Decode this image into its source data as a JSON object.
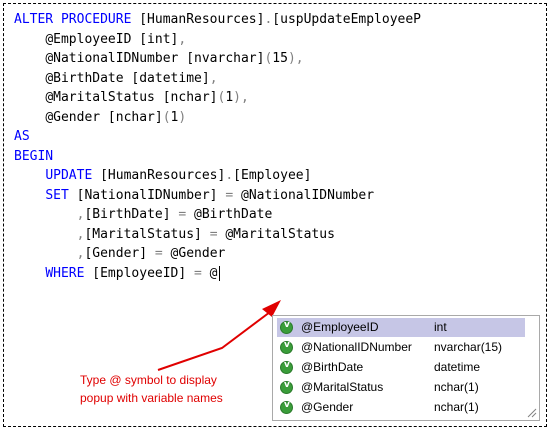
{
  "editor": {
    "lines": [
      {
        "indent": "",
        "segments": [
          {
            "text": "ALTER PROCEDURE",
            "color": "#0000ff"
          },
          {
            "text": " [HumanResources]",
            "color": "#000000"
          },
          {
            "text": ".",
            "color": "#808080"
          },
          {
            "text": "[uspUpdateEmployeeP",
            "color": "#000000"
          }
        ]
      },
      {
        "indent": "    ",
        "segments": [
          {
            "text": "@EmployeeID [int]",
            "color": "#000000"
          },
          {
            "text": ",",
            "color": "#808080"
          }
        ]
      },
      {
        "indent": "    ",
        "segments": [
          {
            "text": "@NationalIDNumber [nvarchar]",
            "color": "#000000"
          },
          {
            "text": "(",
            "color": "#808080"
          },
          {
            "text": "15",
            "color": "#000000"
          },
          {
            "text": "),",
            "color": "#808080"
          }
        ]
      },
      {
        "indent": "    ",
        "segments": [
          {
            "text": "@BirthDate [datetime]",
            "color": "#000000"
          },
          {
            "text": ",",
            "color": "#808080"
          }
        ]
      },
      {
        "indent": "    ",
        "segments": [
          {
            "text": "@MaritalStatus [nchar]",
            "color": "#000000"
          },
          {
            "text": "(",
            "color": "#808080"
          },
          {
            "text": "1",
            "color": "#000000"
          },
          {
            "text": "),",
            "color": "#808080"
          }
        ]
      },
      {
        "indent": "    ",
        "segments": [
          {
            "text": "@Gender [nchar]",
            "color": "#000000"
          },
          {
            "text": "(",
            "color": "#808080"
          },
          {
            "text": "1",
            "color": "#000000"
          },
          {
            "text": ")",
            "color": "#808080"
          }
        ]
      },
      {
        "indent": "",
        "segments": [
          {
            "text": "AS",
            "color": "#0000ff"
          }
        ]
      },
      {
        "indent": "",
        "segments": [
          {
            "text": "BEGIN",
            "color": "#0000ff"
          }
        ]
      },
      {
        "indent": "    ",
        "segments": [
          {
            "text": "UPDATE",
            "color": "#0000ff"
          },
          {
            "text": " [HumanResources]",
            "color": "#000000"
          },
          {
            "text": ".",
            "color": "#808080"
          },
          {
            "text": "[Employee]",
            "color": "#000000"
          }
        ]
      },
      {
        "indent": "    ",
        "segments": [
          {
            "text": "SET",
            "color": "#0000ff"
          },
          {
            "text": " [NationalIDNumber] ",
            "color": "#000000"
          },
          {
            "text": "=",
            "color": "#808080"
          },
          {
            "text": " @NationalIDNumber",
            "color": "#000000"
          }
        ]
      },
      {
        "indent": "        ",
        "segments": [
          {
            "text": ",",
            "color": "#808080"
          },
          {
            "text": "[BirthDate] ",
            "color": "#000000"
          },
          {
            "text": "=",
            "color": "#808080"
          },
          {
            "text": " @BirthDate",
            "color": "#000000"
          }
        ]
      },
      {
        "indent": "        ",
        "segments": [
          {
            "text": ",",
            "color": "#808080"
          },
          {
            "text": "[MaritalStatus] ",
            "color": "#000000"
          },
          {
            "text": "=",
            "color": "#808080"
          },
          {
            "text": " @MaritalStatus",
            "color": "#000000"
          }
        ]
      },
      {
        "indent": "        ",
        "segments": [
          {
            "text": ",",
            "color": "#808080"
          },
          {
            "text": "[Gender] ",
            "color": "#000000"
          },
          {
            "text": "=",
            "color": "#808080"
          },
          {
            "text": " @Gender",
            "color": "#000000"
          }
        ]
      },
      {
        "indent": "    ",
        "caret": true,
        "segments": [
          {
            "text": "WHERE",
            "color": "#0000ff"
          },
          {
            "text": " [EmployeeID] ",
            "color": "#000000"
          },
          {
            "text": "=",
            "color": "#808080"
          },
          {
            "text": " @",
            "color": "#000000"
          }
        ]
      }
    ]
  },
  "completion_popup": {
    "icon": "variable-icon",
    "selected_index": 0,
    "selected_color": "#c6c6e6",
    "items": [
      {
        "name": "@EmployeeID",
        "type": "int"
      },
      {
        "name": "@NationalIDNumber",
        "type": "nvarchar(15)"
      },
      {
        "name": "@BirthDate",
        "type": "datetime"
      },
      {
        "name": "@MaritalStatus",
        "type": "nchar(1)"
      },
      {
        "name": "@Gender",
        "type": "nchar(1)"
      }
    ]
  },
  "annotation": {
    "line1": "Type @ symbol to display",
    "line2": "popup with variable names",
    "color": "#e00000"
  }
}
